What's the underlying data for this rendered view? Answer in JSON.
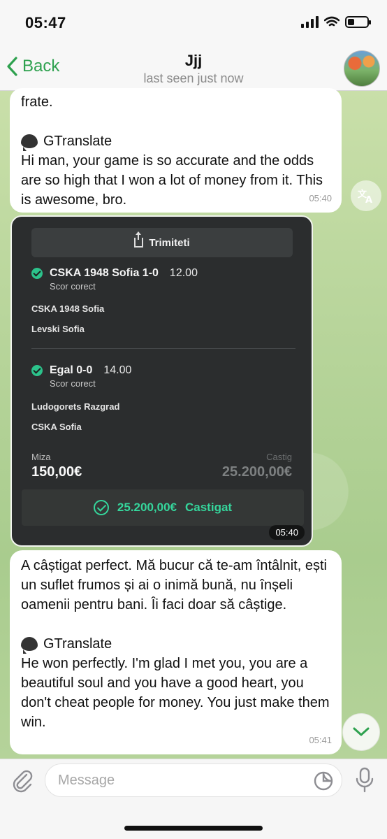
{
  "status_bar": {
    "time": "05:47",
    "battery_level": 0.35
  },
  "header": {
    "back_label": "Back",
    "contact_name": "Jjj",
    "contact_status": "last seen just now"
  },
  "messages": {
    "m1": {
      "partial_line": "frate.",
      "translator": "GTranslate",
      "translation": "Hi man, your game is so accurate and the odds are so high that I won a lot of money from it. This is awesome, bro.",
      "time": "05:40"
    },
    "ticket": {
      "share_label": "Trimiteti",
      "bets": [
        {
          "selection": "CSKA 1948 Sofia 1-0",
          "odds": "12.00",
          "market": "Scor corect",
          "home": "CSKA 1948 Sofia",
          "away": "Levski Sofia"
        },
        {
          "selection": "Egal 0-0",
          "odds": "14.00",
          "market": "Scor corect",
          "home": "Ludogorets Razgrad",
          "away": "CSKA Sofia"
        }
      ],
      "stake_label": "Miza",
      "stake_value": "150,00€",
      "win_label": "Castig",
      "win_value": "25.200,00€",
      "result_amount": "25.200,00€",
      "result_label": "Castigat",
      "time": "05:40"
    },
    "m3": {
      "original": "A câștigat perfect. Mă bucur că te-am întâlnit, ești un suflet frumos și ai o inimă bună, nu înșeli oamenii pentru bani. Îi faci doar să câștige.",
      "translator": "GTranslate",
      "translation": "He won perfectly. I'm glad I met you, you are a beautiful soul and you have a good heart, you don't cheat people for money. You just make them win.",
      "time": "05:41"
    }
  },
  "input": {
    "placeholder": "Message"
  },
  "colors": {
    "accent": "#2ea14f",
    "bet_green": "#35d69c"
  },
  "icons": [
    "chevron-left-icon",
    "translate-icon",
    "share-icon",
    "check-icon",
    "chevron-down-icon",
    "paperclip-icon",
    "sticker-icon",
    "microphone-icon"
  ]
}
